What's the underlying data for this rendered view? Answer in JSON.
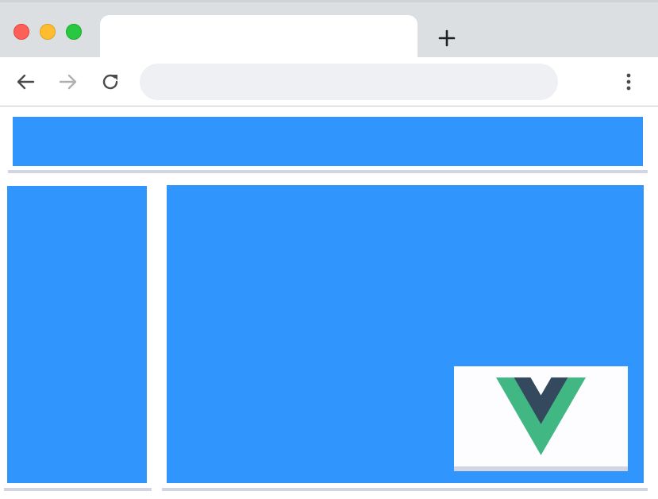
{
  "browser": {
    "tab": {
      "title": ""
    },
    "new_tab_icon": "plus-icon",
    "address_bar": {
      "value": "",
      "placeholder": ""
    },
    "nav_icons": [
      "back-arrow-icon",
      "forward-arrow-icon",
      "reload-icon",
      "more-vert-icon"
    ],
    "window_controls": {
      "close": "#fe5f57",
      "minimize": "#febc2e",
      "maximize": "#28c840"
    }
  },
  "page": {
    "layout_blocks": [
      "header",
      "sidebar",
      "main"
    ],
    "block_color": "#3096fe",
    "logo": {
      "name": "vue-logo",
      "colors": {
        "outer": "#41b883",
        "inner": "#34495e"
      }
    }
  }
}
